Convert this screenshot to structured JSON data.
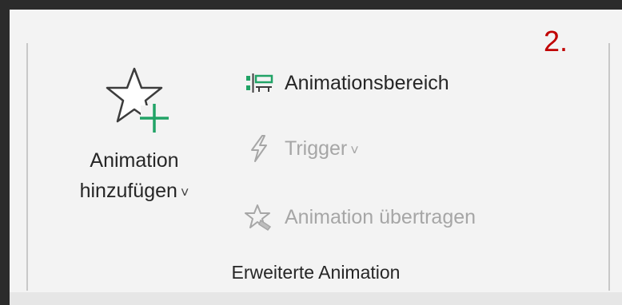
{
  "step_marker": "2.",
  "add_animation": {
    "label_line1": "Animation",
    "label_line2": "hinzufügen",
    "dropdown": "˅"
  },
  "commands": {
    "animation_pane": "Animationsbereich",
    "trigger": "Trigger",
    "trigger_dropdown": "˅",
    "animation_painter": "Animation übertragen"
  },
  "group_label": "Erweiterte Animation",
  "colors": {
    "accent_green": "#21a366",
    "step_red": "#c00000",
    "disabled_gray": "#a6a6a6"
  },
  "icons": {
    "add_animation": "star-plus-icon",
    "animation_pane": "animation-pane-icon",
    "trigger": "lightning-icon",
    "animation_painter": "star-brush-icon"
  }
}
